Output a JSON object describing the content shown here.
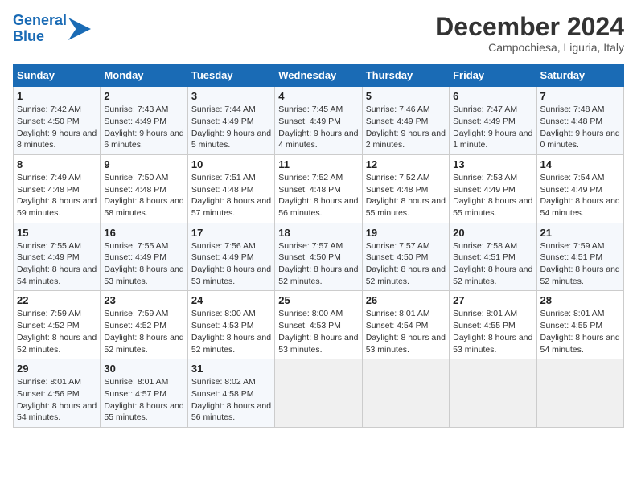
{
  "logo": {
    "line1": "General",
    "line2": "Blue"
  },
  "title": "December 2024",
  "subtitle": "Campochiesa, Liguria, Italy",
  "days_of_week": [
    "Sunday",
    "Monday",
    "Tuesday",
    "Wednesday",
    "Thursday",
    "Friday",
    "Saturday"
  ],
  "weeks": [
    [
      {
        "day": "1",
        "sunrise": "Sunrise: 7:42 AM",
        "sunset": "Sunset: 4:50 PM",
        "daylight": "Daylight: 9 hours and 8 minutes."
      },
      {
        "day": "2",
        "sunrise": "Sunrise: 7:43 AM",
        "sunset": "Sunset: 4:49 PM",
        "daylight": "Daylight: 9 hours and 6 minutes."
      },
      {
        "day": "3",
        "sunrise": "Sunrise: 7:44 AM",
        "sunset": "Sunset: 4:49 PM",
        "daylight": "Daylight: 9 hours and 5 minutes."
      },
      {
        "day": "4",
        "sunrise": "Sunrise: 7:45 AM",
        "sunset": "Sunset: 4:49 PM",
        "daylight": "Daylight: 9 hours and 4 minutes."
      },
      {
        "day": "5",
        "sunrise": "Sunrise: 7:46 AM",
        "sunset": "Sunset: 4:49 PM",
        "daylight": "Daylight: 9 hours and 2 minutes."
      },
      {
        "day": "6",
        "sunrise": "Sunrise: 7:47 AM",
        "sunset": "Sunset: 4:49 PM",
        "daylight": "Daylight: 9 hours and 1 minute."
      },
      {
        "day": "7",
        "sunrise": "Sunrise: 7:48 AM",
        "sunset": "Sunset: 4:48 PM",
        "daylight": "Daylight: 9 hours and 0 minutes."
      }
    ],
    [
      {
        "day": "8",
        "sunrise": "Sunrise: 7:49 AM",
        "sunset": "Sunset: 4:48 PM",
        "daylight": "Daylight: 8 hours and 59 minutes."
      },
      {
        "day": "9",
        "sunrise": "Sunrise: 7:50 AM",
        "sunset": "Sunset: 4:48 PM",
        "daylight": "Daylight: 8 hours and 58 minutes."
      },
      {
        "day": "10",
        "sunrise": "Sunrise: 7:51 AM",
        "sunset": "Sunset: 4:48 PM",
        "daylight": "Daylight: 8 hours and 57 minutes."
      },
      {
        "day": "11",
        "sunrise": "Sunrise: 7:52 AM",
        "sunset": "Sunset: 4:48 PM",
        "daylight": "Daylight: 8 hours and 56 minutes."
      },
      {
        "day": "12",
        "sunrise": "Sunrise: 7:52 AM",
        "sunset": "Sunset: 4:48 PM",
        "daylight": "Daylight: 8 hours and 55 minutes."
      },
      {
        "day": "13",
        "sunrise": "Sunrise: 7:53 AM",
        "sunset": "Sunset: 4:49 PM",
        "daylight": "Daylight: 8 hours and 55 minutes."
      },
      {
        "day": "14",
        "sunrise": "Sunrise: 7:54 AM",
        "sunset": "Sunset: 4:49 PM",
        "daylight": "Daylight: 8 hours and 54 minutes."
      }
    ],
    [
      {
        "day": "15",
        "sunrise": "Sunrise: 7:55 AM",
        "sunset": "Sunset: 4:49 PM",
        "daylight": "Daylight: 8 hours and 54 minutes."
      },
      {
        "day": "16",
        "sunrise": "Sunrise: 7:55 AM",
        "sunset": "Sunset: 4:49 PM",
        "daylight": "Daylight: 8 hours and 53 minutes."
      },
      {
        "day": "17",
        "sunrise": "Sunrise: 7:56 AM",
        "sunset": "Sunset: 4:49 PM",
        "daylight": "Daylight: 8 hours and 53 minutes."
      },
      {
        "day": "18",
        "sunrise": "Sunrise: 7:57 AM",
        "sunset": "Sunset: 4:50 PM",
        "daylight": "Daylight: 8 hours and 52 minutes."
      },
      {
        "day": "19",
        "sunrise": "Sunrise: 7:57 AM",
        "sunset": "Sunset: 4:50 PM",
        "daylight": "Daylight: 8 hours and 52 minutes."
      },
      {
        "day": "20",
        "sunrise": "Sunrise: 7:58 AM",
        "sunset": "Sunset: 4:51 PM",
        "daylight": "Daylight: 8 hours and 52 minutes."
      },
      {
        "day": "21",
        "sunrise": "Sunrise: 7:59 AM",
        "sunset": "Sunset: 4:51 PM",
        "daylight": "Daylight: 8 hours and 52 minutes."
      }
    ],
    [
      {
        "day": "22",
        "sunrise": "Sunrise: 7:59 AM",
        "sunset": "Sunset: 4:52 PM",
        "daylight": "Daylight: 8 hours and 52 minutes."
      },
      {
        "day": "23",
        "sunrise": "Sunrise: 7:59 AM",
        "sunset": "Sunset: 4:52 PM",
        "daylight": "Daylight: 8 hours and 52 minutes."
      },
      {
        "day": "24",
        "sunrise": "Sunrise: 8:00 AM",
        "sunset": "Sunset: 4:53 PM",
        "daylight": "Daylight: 8 hours and 52 minutes."
      },
      {
        "day": "25",
        "sunrise": "Sunrise: 8:00 AM",
        "sunset": "Sunset: 4:53 PM",
        "daylight": "Daylight: 8 hours and 53 minutes."
      },
      {
        "day": "26",
        "sunrise": "Sunrise: 8:01 AM",
        "sunset": "Sunset: 4:54 PM",
        "daylight": "Daylight: 8 hours and 53 minutes."
      },
      {
        "day": "27",
        "sunrise": "Sunrise: 8:01 AM",
        "sunset": "Sunset: 4:55 PM",
        "daylight": "Daylight: 8 hours and 53 minutes."
      },
      {
        "day": "28",
        "sunrise": "Sunrise: 8:01 AM",
        "sunset": "Sunset: 4:55 PM",
        "daylight": "Daylight: 8 hours and 54 minutes."
      }
    ],
    [
      {
        "day": "29",
        "sunrise": "Sunrise: 8:01 AM",
        "sunset": "Sunset: 4:56 PM",
        "daylight": "Daylight: 8 hours and 54 minutes."
      },
      {
        "day": "30",
        "sunrise": "Sunrise: 8:01 AM",
        "sunset": "Sunset: 4:57 PM",
        "daylight": "Daylight: 8 hours and 55 minutes."
      },
      {
        "day": "31",
        "sunrise": "Sunrise: 8:02 AM",
        "sunset": "Sunset: 4:58 PM",
        "daylight": "Daylight: 8 hours and 56 minutes."
      },
      null,
      null,
      null,
      null
    ]
  ]
}
